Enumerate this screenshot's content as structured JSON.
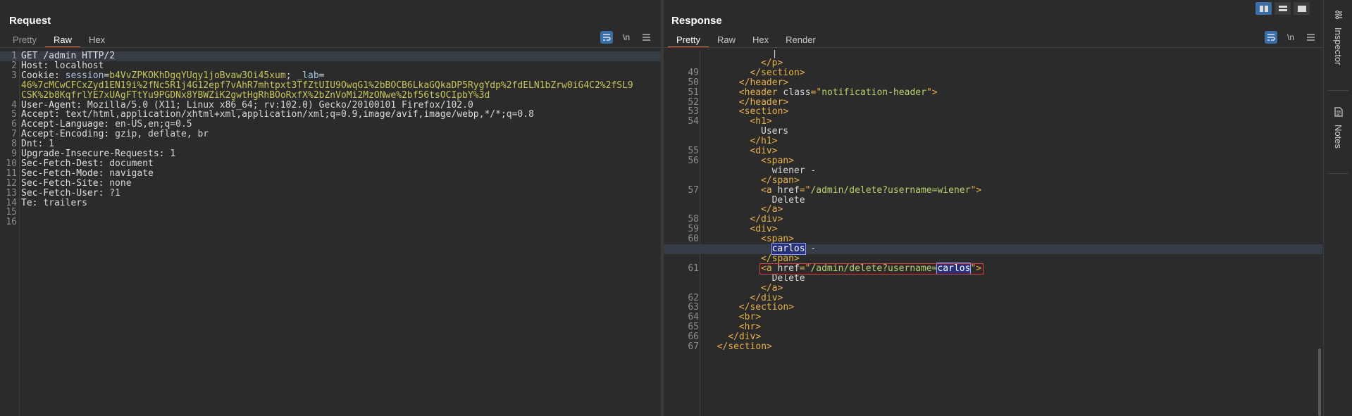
{
  "request": {
    "title": "Request",
    "tabs": [
      "Pretty",
      "Raw",
      "Hex"
    ],
    "active_tab": "Raw",
    "tools": [
      "wrap-icon",
      "\\n",
      "menu-icon"
    ],
    "lines": [
      {
        "n": "1",
        "parts": [
          {
            "t": "GET /admin HTTP/2",
            "c": "k"
          }
        ]
      },
      {
        "n": "2",
        "parts": [
          {
            "t": "Host: ",
            "c": "k"
          },
          {
            "t": "localhost",
            "c": "v"
          }
        ]
      },
      {
        "n": "3",
        "parts": [
          {
            "t": "Cookie: ",
            "c": "k"
          },
          {
            "t": "session",
            "c": "ck"
          },
          {
            "t": "=",
            "c": "v"
          },
          {
            "t": "b4VvZPKOKhDgqYUqy1joBvaw3Oi45xum",
            "c": "cv"
          },
          {
            "t": "; ",
            "c": "v"
          },
          {
            "t": "_lab",
            "c": "ck"
          },
          {
            "t": "=",
            "c": "v"
          }
        ]
      },
      {
        "n": "",
        "parts": [
          {
            "t": "46%7cMCwCFCxZyd1EN19i%2fNc5R1j4G12epf7vAhR7mhtpxt3TfZtUIU9OwqG1%2bBOCB6LkaGQkaDP5RygYdp%2fdELN1bZrw0iG4C2%2fSL9",
            "c": "cv"
          }
        ]
      },
      {
        "n": "",
        "parts": [
          {
            "t": "CSK%2b8KqfrlYE7xUAgFTtYu9PGDNx8YBWZiK2gwtHgRhBOoRxfX%2bZnVoMi2MzONwe%2bf56tsOCIpbY%3d",
            "c": "cv"
          }
        ]
      },
      {
        "n": "4",
        "parts": [
          {
            "t": "User-Agent: ",
            "c": "k"
          },
          {
            "t": "Mozilla/5.0 (X11; Linux x86_64; rv:102.0) Gecko/20100101 Firefox/102.0",
            "c": "v"
          }
        ]
      },
      {
        "n": "5",
        "parts": [
          {
            "t": "Accept: ",
            "c": "k"
          },
          {
            "t": "text/html,application/xhtml+xml,application/xml;q=0.9,image/avif,image/webp,*/*;q=0.8",
            "c": "v"
          }
        ]
      },
      {
        "n": "6",
        "parts": [
          {
            "t": "Accept-Language: ",
            "c": "k"
          },
          {
            "t": "en-US,en;q=0.5",
            "c": "v"
          }
        ]
      },
      {
        "n": "7",
        "parts": [
          {
            "t": "Accept-Encoding: ",
            "c": "k"
          },
          {
            "t": "gzip, deflate, br",
            "c": "v"
          }
        ]
      },
      {
        "n": "8",
        "parts": [
          {
            "t": "Dnt: ",
            "c": "k"
          },
          {
            "t": "1",
            "c": "v"
          }
        ]
      },
      {
        "n": "9",
        "parts": [
          {
            "t": "Upgrade-Insecure-Requests: ",
            "c": "k"
          },
          {
            "t": "1",
            "c": "v"
          }
        ]
      },
      {
        "n": "10",
        "parts": [
          {
            "t": "Sec-Fetch-Dest: ",
            "c": "k"
          },
          {
            "t": "document",
            "c": "v"
          }
        ]
      },
      {
        "n": "11",
        "parts": [
          {
            "t": "Sec-Fetch-Mode: ",
            "c": "k"
          },
          {
            "t": "navigate",
            "c": "v"
          }
        ]
      },
      {
        "n": "12",
        "parts": [
          {
            "t": "Sec-Fetch-Site: ",
            "c": "k"
          },
          {
            "t": "none",
            "c": "v"
          }
        ]
      },
      {
        "n": "13",
        "parts": [
          {
            "t": "Sec-Fetch-User: ",
            "c": "k"
          },
          {
            "t": "?1",
            "c": "v"
          }
        ]
      },
      {
        "n": "14",
        "parts": [
          {
            "t": "Te: ",
            "c": "k"
          },
          {
            "t": "trailers",
            "c": "v"
          }
        ]
      },
      {
        "n": "15",
        "parts": []
      },
      {
        "n": "16",
        "parts": []
      }
    ]
  },
  "response": {
    "title": "Response",
    "tabs": [
      "Pretty",
      "Raw",
      "Hex",
      "Render"
    ],
    "active_tab": "Pretty",
    "tools": [
      "wrap-icon",
      "\\n",
      "menu-icon"
    ],
    "lines": [
      {
        "n": "",
        "ind": 6,
        "parts": [
          {
            "t": "|",
            "c": "txt"
          }
        ]
      },
      {
        "n": "",
        "ind": 5,
        "parts": [
          {
            "t": "</p>",
            "c": "tag"
          }
        ]
      },
      {
        "n": "49",
        "ind": 4,
        "parts": [
          {
            "t": "</section>",
            "c": "tag"
          }
        ]
      },
      {
        "n": "50",
        "ind": 3,
        "parts": [
          {
            "t": "</header>",
            "c": "tag"
          }
        ]
      },
      {
        "n": "51",
        "ind": 3,
        "parts": [
          {
            "t": "<header ",
            "c": "tag"
          },
          {
            "t": "class",
            "c": "attr"
          },
          {
            "t": "=\"",
            "c": "tag"
          },
          {
            "t": "notification-header",
            "c": "str"
          },
          {
            "t": "\">",
            "c": "tag"
          }
        ]
      },
      {
        "n": "52",
        "ind": 3,
        "parts": [
          {
            "t": "</header>",
            "c": "tag"
          }
        ]
      },
      {
        "n": "53",
        "ind": 3,
        "parts": [
          {
            "t": "<section>",
            "c": "tag"
          }
        ]
      },
      {
        "n": "54",
        "ind": 4,
        "parts": [
          {
            "t": "<h1>",
            "c": "tag"
          }
        ]
      },
      {
        "n": "",
        "ind": 5,
        "parts": [
          {
            "t": "Users",
            "c": "txt"
          }
        ]
      },
      {
        "n": "",
        "ind": 4,
        "parts": [
          {
            "t": "</h1>",
            "c": "tag"
          }
        ]
      },
      {
        "n": "55",
        "ind": 4,
        "parts": [
          {
            "t": "<div>",
            "c": "tag"
          }
        ]
      },
      {
        "n": "56",
        "ind": 5,
        "parts": [
          {
            "t": "<span>",
            "c": "tag"
          }
        ]
      },
      {
        "n": "",
        "ind": 6,
        "parts": [
          {
            "t": "wiener -",
            "c": "txt"
          }
        ]
      },
      {
        "n": "",
        "ind": 5,
        "parts": [
          {
            "t": "</span>",
            "c": "tag"
          }
        ]
      },
      {
        "n": "57",
        "ind": 5,
        "parts": [
          {
            "t": "<a ",
            "c": "tag"
          },
          {
            "t": "href",
            "c": "attr"
          },
          {
            "t": "=\"",
            "c": "tag"
          },
          {
            "t": "/admin/delete?username=wiener",
            "c": "str"
          },
          {
            "t": "\">",
            "c": "tag"
          }
        ]
      },
      {
        "n": "",
        "ind": 6,
        "parts": [
          {
            "t": "Delete",
            "c": "txt"
          }
        ]
      },
      {
        "n": "",
        "ind": 5,
        "parts": [
          {
            "t": "</a>",
            "c": "tag"
          }
        ]
      },
      {
        "n": "58",
        "ind": 4,
        "parts": [
          {
            "t": "</div>",
            "c": "tag"
          }
        ]
      },
      {
        "n": "59",
        "ind": 4,
        "parts": [
          {
            "t": "<div>",
            "c": "tag"
          }
        ]
      },
      {
        "n": "60",
        "ind": 5,
        "parts": [
          {
            "t": "<span>",
            "c": "tag"
          }
        ]
      },
      {
        "n": "",
        "ind": 6,
        "hl": true,
        "parts": [
          {
            "t": "carlos",
            "c": "mark"
          },
          {
            "t": " -",
            "c": "txt"
          }
        ]
      },
      {
        "n": "",
        "ind": 5,
        "parts": [
          {
            "t": "</span>",
            "c": "tag"
          }
        ]
      },
      {
        "n": "61",
        "ind": 5,
        "box": true,
        "parts": [
          {
            "t": "<a ",
            "c": "tag"
          },
          {
            "t": "href",
            "c": "attr"
          },
          {
            "t": "=\"",
            "c": "tag"
          },
          {
            "t": "/admin/delete?username=",
            "c": "str"
          },
          {
            "t": "carlos",
            "c": "mark"
          },
          {
            "t": "\">",
            "c": "tag"
          }
        ]
      },
      {
        "n": "",
        "ind": 6,
        "parts": [
          {
            "t": "Delete",
            "c": "txt"
          }
        ]
      },
      {
        "n": "",
        "ind": 5,
        "parts": [
          {
            "t": "</a>",
            "c": "tag"
          }
        ]
      },
      {
        "n": "62",
        "ind": 4,
        "parts": [
          {
            "t": "</div>",
            "c": "tag"
          }
        ]
      },
      {
        "n": "63",
        "ind": 3,
        "parts": [
          {
            "t": "</section>",
            "c": "tag"
          }
        ]
      },
      {
        "n": "64",
        "ind": 3,
        "parts": [
          {
            "t": "<br>",
            "c": "tag"
          }
        ]
      },
      {
        "n": "65",
        "ind": 3,
        "parts": [
          {
            "t": "<hr>",
            "c": "tag"
          }
        ]
      },
      {
        "n": "66",
        "ind": 2,
        "parts": [
          {
            "t": "</div>",
            "c": "tag"
          }
        ]
      },
      {
        "n": "67",
        "ind": 1,
        "parts": [
          {
            "t": "</section>",
            "c": "tag"
          }
        ]
      }
    ]
  },
  "sidebar": {
    "items": [
      {
        "label": "Inspector",
        "icon": "inspector-icon"
      },
      {
        "label": "Notes",
        "icon": "notes-icon"
      }
    ]
  },
  "view_modes": [
    "side-by-side",
    "stacked",
    "single"
  ]
}
